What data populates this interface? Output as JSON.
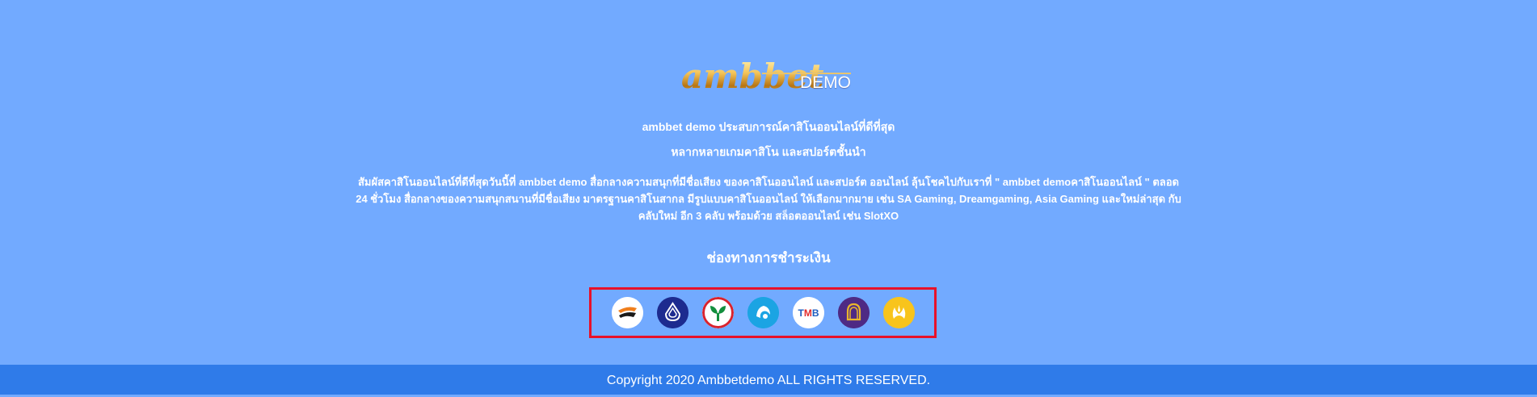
{
  "logo": {
    "word": "ambbet",
    "suffix": "DEMO"
  },
  "taglines": [
    "ambbet demo ประสบการณ์คาสิโนออนไลน์ที่ดีที่สุด",
    "หลากหลายเกมคาสิโน และสปอร์ตชั้นนำ"
  ],
  "description": "สัมผัสคาสิโนออนไลน์ที่ดีที่สุดวันนี้ที่ ambbet demo สื่อกลางความสนุกที่มีชื่อเสียง ของคาสิโนออนไลน์ และสปอร์ต ออนไลน์ ลุ้นโชคไปกับเราที่ \" ambbet demoคาสิโนออนไลน์ \" ตลอด 24 ชั่วโมง สื่อกลางของความสนุกสนานที่มีชื่อเสียง มาตรฐานคาสิโนสากล มีรูปแบบคาสิโนออนไลน์ ให้เลือกมากมาย เช่น SA Gaming, Dreamgaming, Asia Gaming และใหม่ล่าสุด กับคลับใหม่ อีก 3 คลับ พร้อมด้วย สล็อตออนไลน์ เช่น SlotXO",
  "payments": {
    "title": "ช่องทางการชำระเงิน",
    "banks": [
      {
        "icon": "thanachart-bank-icon",
        "color": "#ffffff"
      },
      {
        "icon": "bangkok-bank-icon",
        "color": "#1d2b8f"
      },
      {
        "icon": "kasikorn-bank-icon",
        "color": "#ffffff"
      },
      {
        "icon": "krungthai-bank-icon",
        "color": "#1ba4e3"
      },
      {
        "icon": "tmb-bank-icon",
        "color": "#ffffff",
        "label": "TMB"
      },
      {
        "icon": "siam-commercial-bank-icon",
        "color": "#4e2a84"
      },
      {
        "icon": "krungsri-bank-icon",
        "color": "#f8c41c"
      }
    ]
  },
  "footer": {
    "copyright": "Copyright 2020 Ambbetdemo ALL RIGHTS RESERVED."
  },
  "colors": {
    "background": "#72aaff",
    "footer": "#2f7be9",
    "highlight_border": "#e8112a"
  }
}
